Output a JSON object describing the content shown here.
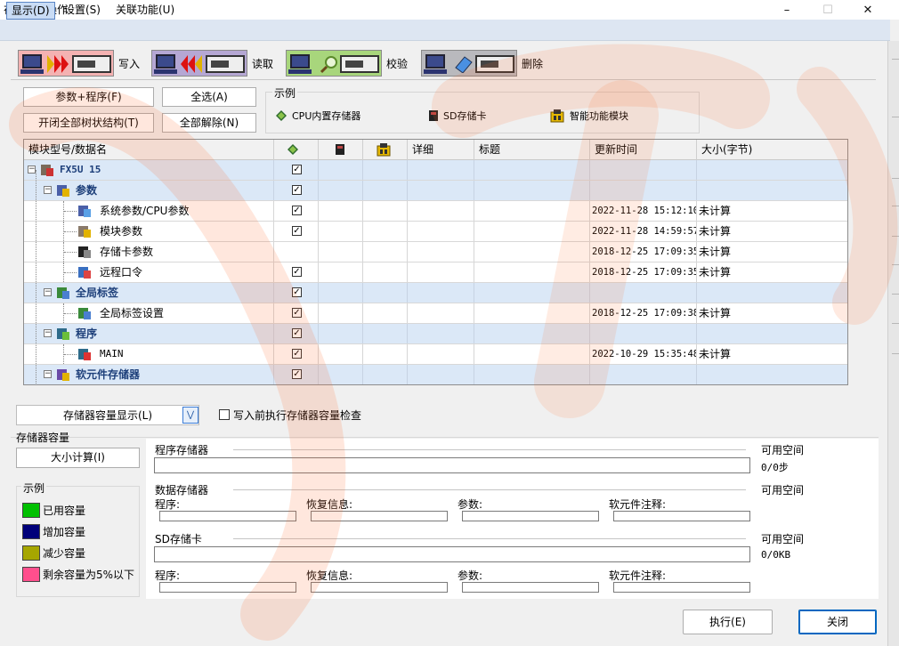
{
  "window": {
    "title": "在线数据操作",
    "minimize": "–",
    "maximize": "☐",
    "close": "✕"
  },
  "menubar": {
    "items": [
      "显示(D)",
      "设置(S)",
      "关联功能(U)"
    ]
  },
  "modes": [
    {
      "label": "写入",
      "color": "#f4b2b2"
    },
    {
      "label": "读取",
      "color": "#b5a7d4"
    },
    {
      "label": "校验",
      "color": "#a8d67c"
    },
    {
      "label": "删除",
      "color": "#b9b9bd"
    }
  ],
  "actions": {
    "param_program": "参数+程序(F)",
    "select_all": "全选(A)",
    "toggle_tree": "开闭全部树状结构(T)",
    "deselect_all": "全部解除(N)"
  },
  "sample": {
    "title": "示例",
    "items": [
      {
        "label": "CPU内置存储器",
        "icon": "cpu-memory-icon"
      },
      {
        "label": "SD存储卡",
        "icon": "sd-card-icon"
      },
      {
        "label": "智能功能模块",
        "icon": "intelligent-module-icon"
      }
    ]
  },
  "grid": {
    "columns": [
      "模块型号/数据名",
      "",
      "",
      "",
      "详细",
      "标题",
      "更新时间",
      "大小(字节)"
    ],
    "rows": [
      {
        "name": "FX5U 15",
        "group": true,
        "level": 0,
        "checked": true,
        "time": "",
        "size": "",
        "icon": "plc-icon"
      },
      {
        "name": "参数",
        "group": true,
        "level": 1,
        "checked": true,
        "time": "",
        "size": "",
        "icon": "parameter-icon"
      },
      {
        "name": "系统参数/CPU参数",
        "group": false,
        "level": 2,
        "checked": true,
        "time": "2022-11-28 15:12:10",
        "size": "未计算",
        "icon": "system-parameter-icon"
      },
      {
        "name": "模块参数",
        "group": false,
        "level": 2,
        "checked": true,
        "time": "2022-11-28 14:59:57",
        "size": "未计算",
        "icon": "module-parameter-icon"
      },
      {
        "name": "存储卡参数",
        "group": false,
        "level": 2,
        "checked": false,
        "time": "2018-12-25 17:09:35",
        "size": "未计算",
        "icon": "memory-card-parameter-icon"
      },
      {
        "name": "远程口令",
        "group": false,
        "level": 2,
        "checked": true,
        "time": "2018-12-25 17:09:35",
        "size": "未计算",
        "icon": "remote-password-icon"
      },
      {
        "name": "全局标签",
        "group": true,
        "level": 1,
        "checked": true,
        "time": "",
        "size": "",
        "icon": "global-label-icon"
      },
      {
        "name": "全局标签设置",
        "group": false,
        "level": 2,
        "checked": true,
        "time": "2018-12-25 17:09:38",
        "size": "未计算",
        "icon": "global-label-setting-icon"
      },
      {
        "name": "程序",
        "group": true,
        "level": 1,
        "checked": true,
        "time": "",
        "size": "",
        "icon": "program-icon"
      },
      {
        "name": "MAIN",
        "group": false,
        "level": 2,
        "checked": true,
        "time": "2022-10-29 15:35:48",
        "size": "未计算",
        "icon": "main-program-icon"
      },
      {
        "name": "软元件存储器",
        "group": true,
        "level": 1,
        "checked": true,
        "time": "",
        "size": "",
        "icon": "device-memory-icon"
      }
    ]
  },
  "memory": {
    "dropdown_label": "存储器容量显示(L)",
    "check_label": "写入前执行存储器容量检查",
    "check_checked": false,
    "section_title": "存储器容量",
    "calc_button": "大小计算(I)",
    "legend": {
      "title": "示例",
      "items": [
        {
          "label": "已用容量",
          "color": "#00c000"
        },
        {
          "label": "增加容量",
          "color": "#00007a"
        },
        {
          "label": "减少容量",
          "color": "#a6a600"
        },
        {
          "label": "剩余容量为5%以下",
          "color": "#ff4f8d"
        }
      ]
    },
    "program_memory": {
      "title": "程序存储器",
      "free_label": "可用空间",
      "value": "0/0步"
    },
    "data_memory": {
      "title": "数据存储器",
      "free_label": "可用空间",
      "fields": [
        "程序:",
        "恢复信息:",
        "参数:",
        "软元件注释:"
      ]
    },
    "sd_card": {
      "title": "SD存储卡",
      "free_label": "可用空间",
      "value": "0/0KB",
      "fields": [
        "程序:",
        "恢复信息:",
        "参数:",
        "软元件注释:"
      ]
    }
  },
  "footer": {
    "execute": "执行(E)",
    "close": "关闭"
  }
}
